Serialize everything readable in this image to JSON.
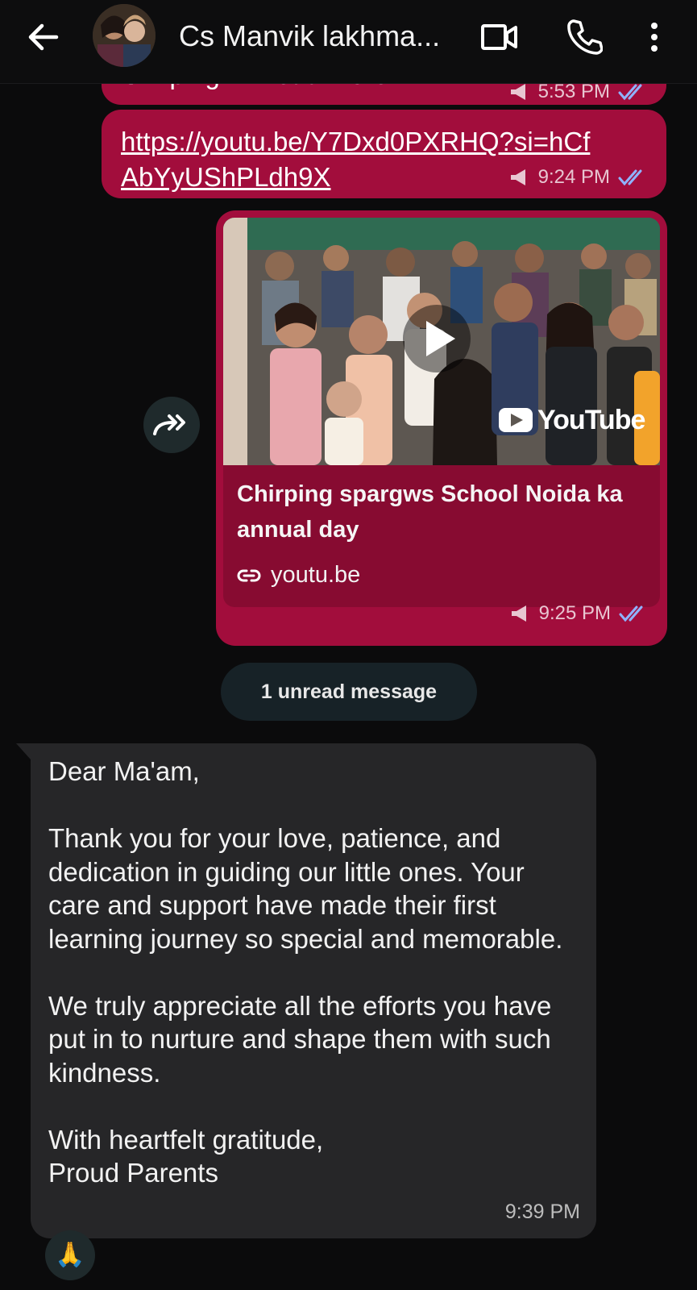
{
  "header": {
    "title": "Cs Manvik lakhma...",
    "icons": [
      "back-arrow-icon",
      "video-call-icon",
      "phone-icon",
      "more-vertical-icon"
    ]
  },
  "messages": {
    "prev_partial": {
      "text": "Chirping ... Read more",
      "time": "5:53 PM"
    },
    "link_message": {
      "url": "https://youtu.be/Y7Dxd0PXRHQ?si=hCfAbYyUShPLdh9X",
      "time": "9:24 PM"
    },
    "preview_message": {
      "title": "Chirping spargws School Noida ka annual day",
      "domain": "youtu.be",
      "watermark": "YouTube",
      "time": "9:25 PM"
    },
    "unread_label": "1 unread message",
    "incoming": {
      "paragraphs": [
        "Dear Ma'am,",
        "Thank you for your love, patience, and dedication in guiding our little ones. Your care and support have made their first learning journey so special and memorable.",
        "We truly appreciate all the efforts you have put in to nurture and shape them with such kindness.",
        "With heartfelt gratitude, Proud Parents"
      ],
      "time": "9:39 PM",
      "reaction": "🙏"
    }
  },
  "colors": {
    "outgoing_bubble": "#a20d3c",
    "incoming_bubble": "#262628",
    "background": "#0b0b0c",
    "read_tick": "#8fb3ff"
  }
}
